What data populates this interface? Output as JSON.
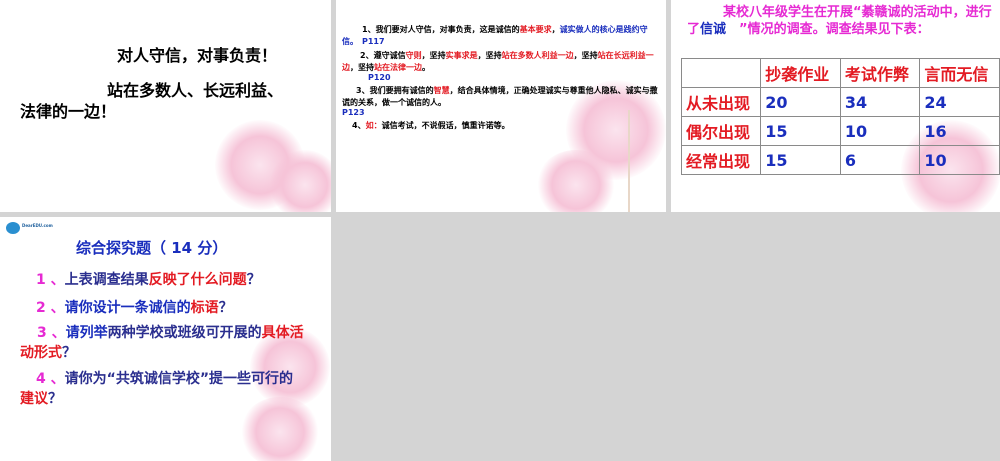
{
  "slide1": {
    "line1": "对人守信，对事负责！",
    "line2a": "站在多数人、长远利益、",
    "line2b": "法律的一边！"
  },
  "slide2": {
    "p1": [
      "1、我们要对人守信，对事负责，这是诚信的",
      "基本要求",
      "，",
      "诚实做人的核心是践约守信。",
      "P117"
    ],
    "p2": [
      "2、遵守诚信",
      "守则",
      "，坚持",
      "实事求是",
      "，坚持",
      "站在多数人利益一边",
      "，坚持",
      "站在长远利益一边",
      "，坚持",
      "站在法律一边",
      "。"
    ],
    "p2ref": "P120",
    "p3": [
      "3、我们要拥有诚信的",
      "智慧",
      "，结合具体情境，正确处理诚实与尊重他人隐私、诚实与撒谎的关系，做一个诚信的人。"
    ],
    "p3ref": "P123",
    "p4": [
      "4、",
      "如：",
      "诚信考试，不说假话，慎重许诺等。"
    ]
  },
  "slide3": {
    "title_a": "某校八年级学生在开展“",
    "title_b": "綦赣诚",
    "title_c": "的活动中，进行了",
    "title_d": "信诚",
    "title_e": "　”情况的调查。调查结果见下表：",
    "headers": [
      "",
      "抄袭作业",
      "考试作弊",
      "言而无信"
    ],
    "rows": [
      [
        "从未出现",
        "20",
        "34",
        "24"
      ],
      [
        "偶尔出现",
        "15",
        "10",
        "16"
      ],
      [
        "经常出现",
        "15",
        "6",
        "10"
      ]
    ]
  },
  "slide4": {
    "logo": "DearEDU.com",
    "title": "综合探究题（ 14 分）",
    "q1": [
      "1 、",
      "上表调查结果",
      "反映了什么问题",
      "？"
    ],
    "q2": [
      "2 、",
      "请你设计一条诚信的",
      "标语",
      "？"
    ],
    "q3": [
      "3 、",
      "请列举",
      "两种学校或班级可开展的",
      "具体活动形式",
      "？"
    ],
    "q4": [
      "4 、",
      "请你为“共筑诚信学校”提一些可行的",
      "建议",
      "？"
    ]
  }
}
